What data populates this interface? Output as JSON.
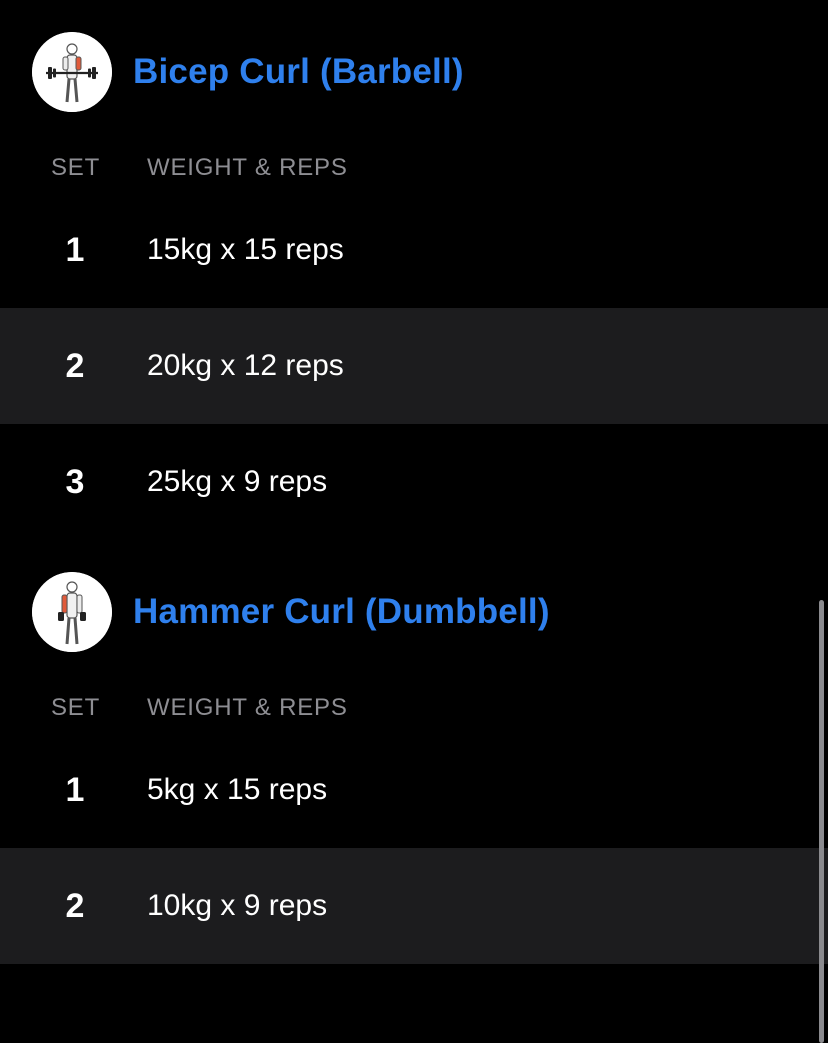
{
  "exercises": [
    {
      "name": "Bicep Curl (Barbell)",
      "thumbnail_icon": "barbell-curl-figure-icon",
      "columns": {
        "set": "SET",
        "weight_reps": "WEIGHT & REPS"
      },
      "sets": [
        {
          "number": "1",
          "value": "15kg x 15 reps"
        },
        {
          "number": "2",
          "value": "20kg x 12 reps"
        },
        {
          "number": "3",
          "value": "25kg x 9 reps"
        }
      ]
    },
    {
      "name": "Hammer Curl (Dumbbell)",
      "thumbnail_icon": "dumbbell-curl-figure-icon",
      "columns": {
        "set": "SET",
        "weight_reps": "WEIGHT & REPS"
      },
      "sets": [
        {
          "number": "1",
          "value": "5kg x 15 reps"
        },
        {
          "number": "2",
          "value": "10kg x 9 reps"
        }
      ]
    }
  ],
  "colors": {
    "background": "#000000",
    "alt_row": "#1c1c1e",
    "title_accent": "#2f80ed",
    "header_text": "#8e8e93",
    "text": "#ffffff"
  }
}
